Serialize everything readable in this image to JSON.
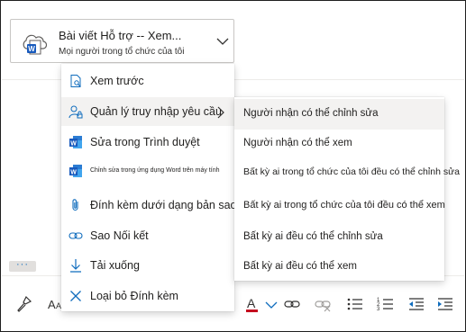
{
  "attachment": {
    "title": "Bài viết Hỗ trợ -- Xem...",
    "subtitle": "Mọi người trong tổ chức của tôi",
    "icon": "cloud-word-file-icon",
    "brand_color": "#185abd"
  },
  "menu": {
    "items": [
      {
        "label": "Xem trước",
        "icon": "preview-icon"
      },
      {
        "label": "Quản lý truy nhập yêu cầu",
        "icon": "manage-access-icon"
      },
      {
        "label": "Sửa trong Trình duyệt",
        "icon": "word-icon"
      },
      {
        "label": "Chỉnh sửa trong ứng dụng Word trên máy tính",
        "icon": "word-icon"
      },
      {
        "label": "Đính kèm dưới dạng bản sao",
        "icon": "paperclip-icon"
      },
      {
        "label": "Sao Nối kết",
        "icon": "link-icon"
      },
      {
        "label": "Tải xuống",
        "icon": "download-icon"
      },
      {
        "label": "Loại bỏ Đính kèm",
        "icon": "close-icon"
      }
    ]
  },
  "submenu": {
    "items": [
      {
        "label": "Người nhận có thể chỉnh sửa"
      },
      {
        "label": "Người nhận có thể xem"
      },
      {
        "label": "Bất kỳ ai trong tổ chức của tôi đều có thể chỉnh sửa"
      },
      {
        "label": "Bất kỳ ai trong tổ chức của tôi đều có thể xem"
      },
      {
        "label": "Bất kỳ ai đều có thể chỉnh sửa"
      },
      {
        "label": "Bất kỳ ai đều có thể xem"
      }
    ]
  },
  "more_button": {
    "label": "···"
  },
  "toolbar": {
    "items": [
      "format-painter-icon",
      "font-size-icon",
      "font-color-icon",
      "chevron-down-icon",
      "insert-link-icon",
      "remove-link-icon",
      "bullets-icon",
      "numbering-icon",
      "decrease-indent-icon",
      "increase-indent-icon"
    ]
  },
  "colors": {
    "accent": "#0f6cbd",
    "font_color_bar": "#c50f1f",
    "word_blue": "#185abd"
  }
}
